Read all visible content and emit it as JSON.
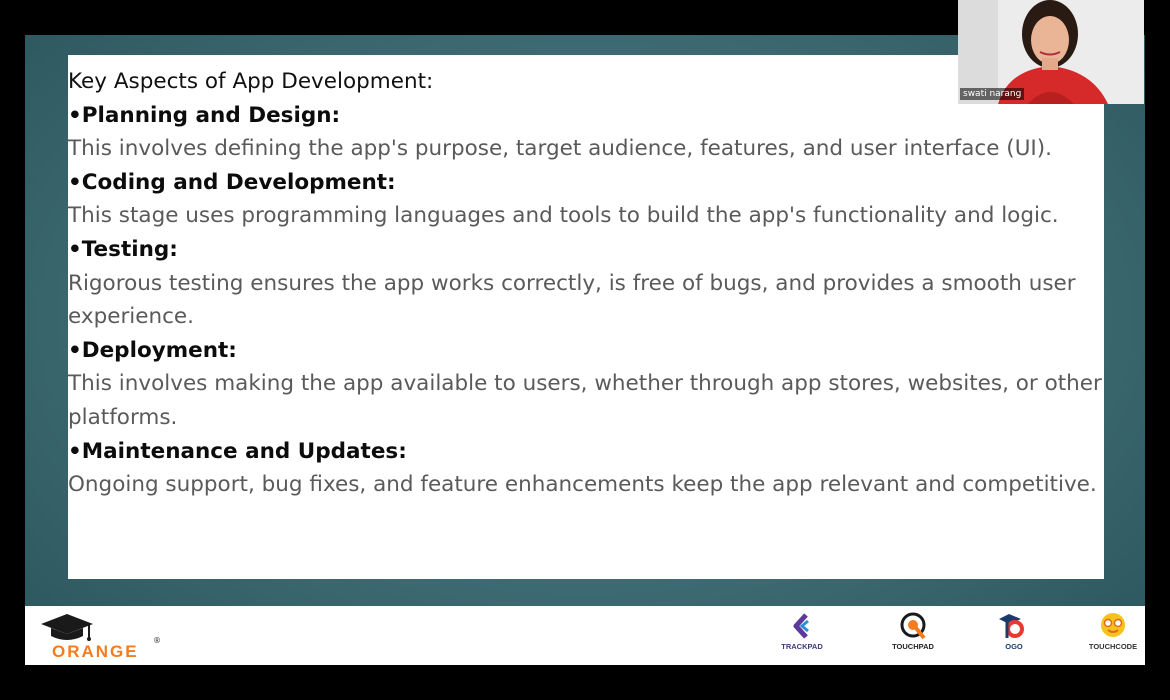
{
  "slide": {
    "heading": "Key Aspects of App Development:",
    "bullets": [
      {
        "title": "Planning and Design:",
        "text": "This involves defining the app's purpose, target audience, features, and user interface (UI)."
      },
      {
        "title": "Coding and Development:",
        "text": "This stage uses programming languages and tools to build the app's functionality and logic."
      },
      {
        "title": "Testing:",
        "text": "Rigorous testing ensures the app works correctly, is free of bugs, and provides a smooth user experience."
      },
      {
        "title": "Deployment:",
        "text": "This involves making the app available to users, whether through app stores, websites, or other platforms."
      },
      {
        "title": "Maintenance and Updates:",
        "text": "Ongoing support, bug fixes, and feature enhancements keep the app relevant and competitive."
      }
    ],
    "bullet_glyph": "•"
  },
  "footer": {
    "brand": "ORANGE",
    "brand_mark": "®",
    "partners": [
      {
        "label": "TRACKPAD",
        "icon": "trackpad-logo-icon"
      },
      {
        "label": "TOUCHPAD",
        "icon": "touchpad-logo-icon"
      },
      {
        "label": "OGO",
        "icon": "ogo-logo-icon"
      },
      {
        "label": "TOUCHCODE",
        "icon": "touchcode-logo-icon"
      }
    ]
  },
  "webcam": {
    "participant_name": "swati narang"
  },
  "colors": {
    "background": "#000000",
    "slide_teal": "#3d6a72",
    "brand_orange": "#f47c20",
    "text_body": "#5a5a5a",
    "text_title": "#0c0c0c"
  }
}
